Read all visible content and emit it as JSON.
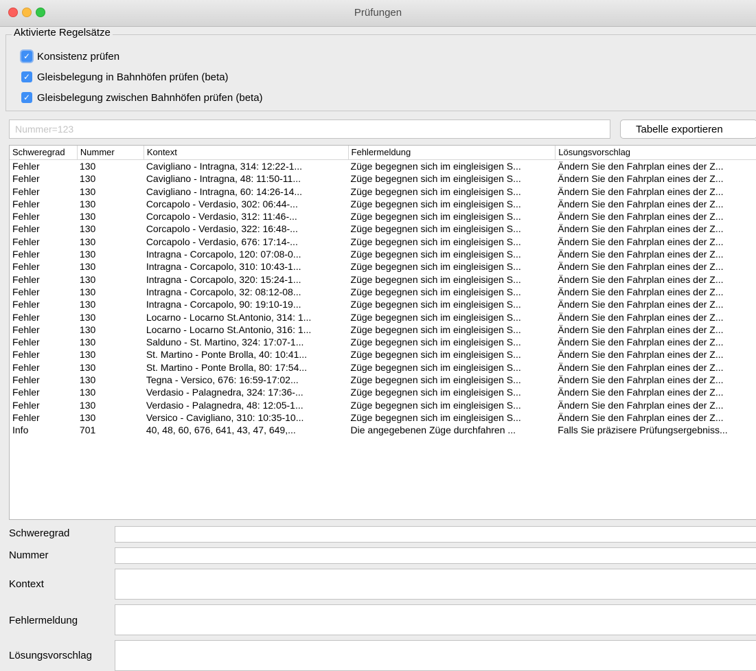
{
  "window": {
    "title": "Prüfungen"
  },
  "rulesets": {
    "legend": "Aktivierte Regelsätze",
    "items": [
      {
        "label": "Konsistenz prüfen",
        "checked": true
      },
      {
        "label": "Gleisbelegung in Bahnhöfen prüfen (beta)",
        "checked": true
      },
      {
        "label": "Gleisbelegung zwischen Bahnhöfen prüfen (beta)",
        "checked": true
      }
    ]
  },
  "filter": {
    "placeholder": "Nummer=123",
    "value": ""
  },
  "export_button": {
    "label": "Tabelle exportieren"
  },
  "table": {
    "columns": [
      "Schweregrad",
      "Nummer",
      "Kontext",
      "Fehlermeldung",
      "Lösungsvorschlag"
    ],
    "rows": [
      [
        "Fehler",
        "130",
        "Cavigliano - Intragna, 314: 12:22-1...",
        "Züge begegnen sich im eingleisigen S...",
        "Ändern Sie den Fahrplan eines der Z..."
      ],
      [
        "Fehler",
        "130",
        "Cavigliano - Intragna, 48: 11:50-11...",
        "Züge begegnen sich im eingleisigen S...",
        "Ändern Sie den Fahrplan eines der Z..."
      ],
      [
        "Fehler",
        "130",
        "Cavigliano - Intragna, 60: 14:26-14...",
        "Züge begegnen sich im eingleisigen S...",
        "Ändern Sie den Fahrplan eines der Z..."
      ],
      [
        "Fehler",
        "130",
        "Corcapolo - Verdasio, 302: 06:44-...",
        "Züge begegnen sich im eingleisigen S...",
        "Ändern Sie den Fahrplan eines der Z..."
      ],
      [
        "Fehler",
        "130",
        "Corcapolo - Verdasio, 312: 11:46-...",
        "Züge begegnen sich im eingleisigen S...",
        "Ändern Sie den Fahrplan eines der Z..."
      ],
      [
        "Fehler",
        "130",
        "Corcapolo - Verdasio, 322: 16:48-...",
        "Züge begegnen sich im eingleisigen S...",
        "Ändern Sie den Fahrplan eines der Z..."
      ],
      [
        "Fehler",
        "130",
        "Corcapolo - Verdasio, 676: 17:14-...",
        "Züge begegnen sich im eingleisigen S...",
        "Ändern Sie den Fahrplan eines der Z..."
      ],
      [
        "Fehler",
        "130",
        "Intragna - Corcapolo, 120: 07:08-0...",
        "Züge begegnen sich im eingleisigen S...",
        "Ändern Sie den Fahrplan eines der Z..."
      ],
      [
        "Fehler",
        "130",
        "Intragna - Corcapolo, 310: 10:43-1...",
        "Züge begegnen sich im eingleisigen S...",
        "Ändern Sie den Fahrplan eines der Z..."
      ],
      [
        "Fehler",
        "130",
        "Intragna - Corcapolo, 320: 15:24-1...",
        "Züge begegnen sich im eingleisigen S...",
        "Ändern Sie den Fahrplan eines der Z..."
      ],
      [
        "Fehler",
        "130",
        "Intragna - Corcapolo, 32: 08:12-08...",
        "Züge begegnen sich im eingleisigen S...",
        "Ändern Sie den Fahrplan eines der Z..."
      ],
      [
        "Fehler",
        "130",
        "Intragna - Corcapolo, 90: 19:10-19...",
        "Züge begegnen sich im eingleisigen S...",
        "Ändern Sie den Fahrplan eines der Z..."
      ],
      [
        "Fehler",
        "130",
        "Locarno - Locarno St.Antonio, 314: 1...",
        "Züge begegnen sich im eingleisigen S...",
        "Ändern Sie den Fahrplan eines der Z..."
      ],
      [
        "Fehler",
        "130",
        "Locarno - Locarno St.Antonio, 316: 1...",
        "Züge begegnen sich im eingleisigen S...",
        "Ändern Sie den Fahrplan eines der Z..."
      ],
      [
        "Fehler",
        "130",
        "Salduno - St. Martino, 324: 17:07-1...",
        "Züge begegnen sich im eingleisigen S...",
        "Ändern Sie den Fahrplan eines der Z..."
      ],
      [
        "Fehler",
        "130",
        "St. Martino - Ponte Brolla, 40: 10:41...",
        "Züge begegnen sich im eingleisigen S...",
        "Ändern Sie den Fahrplan eines der Z..."
      ],
      [
        "Fehler",
        "130",
        "St. Martino - Ponte Brolla, 80: 17:54...",
        "Züge begegnen sich im eingleisigen S...",
        "Ändern Sie den Fahrplan eines der Z..."
      ],
      [
        "Fehler",
        "130",
        "Tegna - Versico, 676: 16:59-17:02...",
        "Züge begegnen sich im eingleisigen S...",
        "Ändern Sie den Fahrplan eines der Z..."
      ],
      [
        "Fehler",
        "130",
        "Verdasio - Palagnedra, 324: 17:36-...",
        "Züge begegnen sich im eingleisigen S...",
        "Ändern Sie den Fahrplan eines der Z..."
      ],
      [
        "Fehler",
        "130",
        "Verdasio - Palagnedra, 48: 12:05-1...",
        "Züge begegnen sich im eingleisigen S...",
        "Ändern Sie den Fahrplan eines der Z..."
      ],
      [
        "Fehler",
        "130",
        "Versico - Cavigliano, 310: 10:35-10...",
        "Züge begegnen sich im eingleisigen S...",
        "Ändern Sie den Fahrplan eines der Z..."
      ],
      [
        "Info",
        "701",
        "40, 48, 60, 676, 641, 43, 47, 649,...",
        "Die angegebenen Züge durchfahren ...",
        "Falls Sie präzisere Prüfungsergebniss..."
      ]
    ]
  },
  "details": {
    "severity_label": "Schweregrad",
    "number_label": "Nummer",
    "context_label": "Kontext",
    "message_label": "Fehlermeldung",
    "solution_label": "Lösungsvorschlag"
  }
}
